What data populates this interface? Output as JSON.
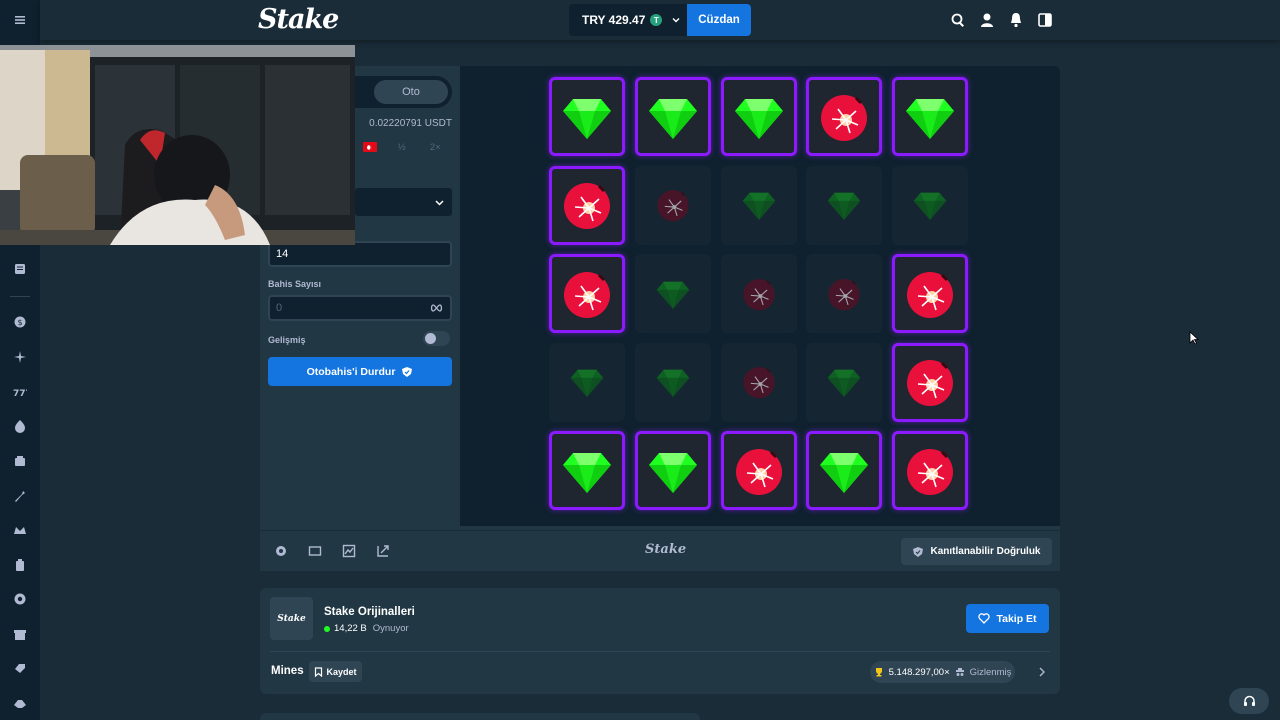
{
  "header": {
    "logo": "Stake",
    "balance": "TRY 429.47",
    "token_symbol": "T",
    "wallet_label": "Cüzdan"
  },
  "webcam": {
    "description": "streamer webcam overlay"
  },
  "side_panel": {
    "tab_auto": "Oto",
    "amount": "0.02220791 USDT",
    "half": "½",
    "double": "2×",
    "mines_field_value": "14",
    "bet_count_label": "Bahis Sayısı",
    "bet_count_placeholder": "0",
    "advanced_label": "Gelişmiş",
    "stop_button": "Otobahis'i Durdur"
  },
  "board": {
    "tiles": [
      [
        "gem-rev",
        "gem-rev",
        "gem-rev",
        "mine-rev",
        "gem-rev"
      ],
      [
        "mine-rev",
        "mine",
        "gem",
        "gem",
        "gem"
      ],
      [
        "mine-rev",
        "gem",
        "mine",
        "mine",
        "mine-rev"
      ],
      [
        "gem",
        "gem",
        "mine",
        "gem",
        "mine-rev"
      ],
      [
        "gem-rev",
        "gem-rev",
        "mine-rev",
        "gem-rev",
        "mine-rev"
      ]
    ]
  },
  "game_footer": {
    "logo": "Stake",
    "fair_button": "Kanıtlanabilir Doğruluk"
  },
  "info": {
    "avatar_text": "Stake",
    "title": "Stake Orijinalleri",
    "playing_count": "14,22 B",
    "playing_label": "Oynuyor",
    "follow_button": "Takip Et",
    "game_name": "Mines",
    "save_button": "Kaydet",
    "record_value": "5.148.297,00×",
    "record_user": "Gizlenmiş"
  },
  "colors": {
    "accent": "#1475e1",
    "tile_border": "#8b1aff",
    "gem": "#1fff20",
    "mine": "#e9113c"
  }
}
